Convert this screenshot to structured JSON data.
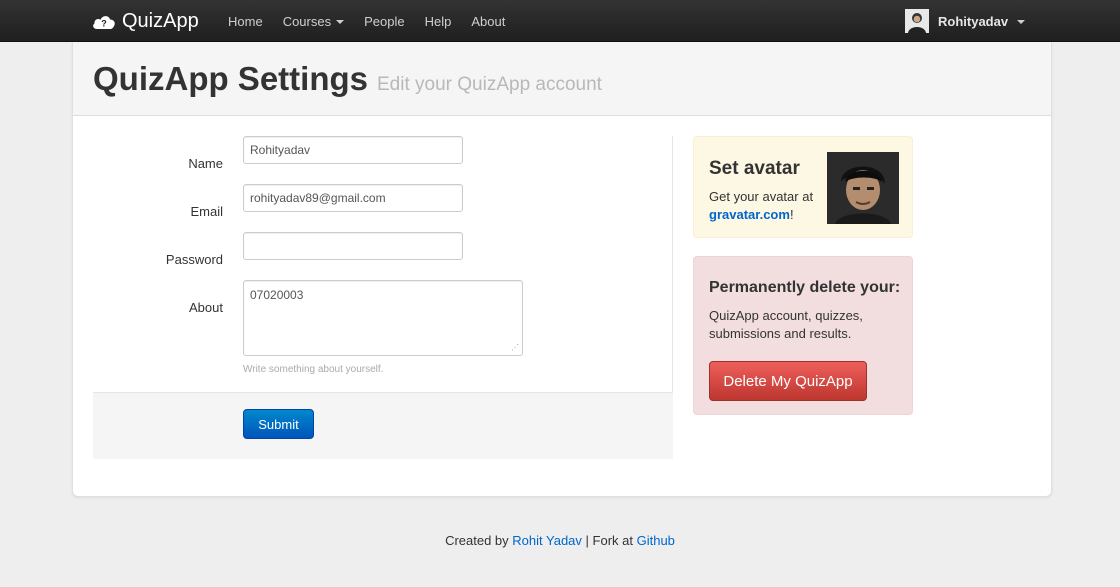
{
  "navbar": {
    "brand": "QuizApp",
    "links": [
      {
        "label": "Home"
      },
      {
        "label": "Courses"
      },
      {
        "label": "People"
      },
      {
        "label": "Help"
      },
      {
        "label": "About"
      }
    ],
    "user": "Rohityadav"
  },
  "header": {
    "title": "QuizApp Settings",
    "subtitle": "Edit your QuizApp account"
  },
  "form": {
    "name_label": "Name",
    "name_value": "Rohityadav",
    "email_label": "Email",
    "email_value": "rohityadav89@gmail.com",
    "password_label": "Password",
    "password_value": "",
    "about_label": "About",
    "about_value": "07020003",
    "about_help": "Write something about yourself.",
    "submit_label": "Submit"
  },
  "avatar_box": {
    "title": "Set avatar",
    "text_before": "Get your avatar at",
    "link": "gravatar.com",
    "text_after": "!"
  },
  "delete_box": {
    "title": "Permanently delete your:",
    "text": "QuizApp account, quizzes, submissions and results.",
    "button_label": "Delete My QuizApp"
  },
  "footer": {
    "created_by": "Created by",
    "author": "Rohit Yadav",
    "separator": "| Fork at",
    "repo": "Github"
  },
  "colors": {
    "primary": "#0088cc",
    "danger": "#da4f49",
    "warning_bg": "#fcf8e3",
    "danger_bg": "#f2dede"
  }
}
